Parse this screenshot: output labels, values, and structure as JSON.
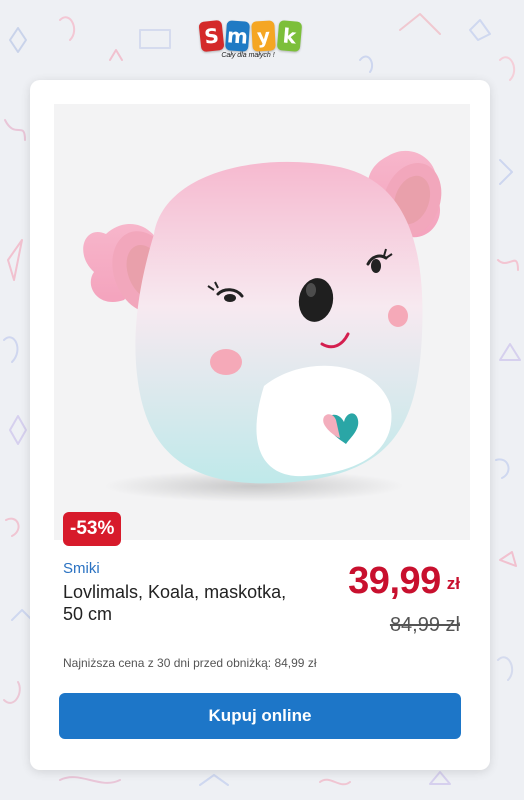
{
  "logo": {
    "letters": [
      "S",
      "m",
      "y",
      "k",
      ""
    ],
    "tagline": "Cały dla małych !",
    "letter_colors": [
      "#d42a2a",
      "#1f7ac4",
      "#f5a623",
      "#7cbf3a",
      "#8e44ad"
    ]
  },
  "product": {
    "discount": "-53%",
    "brand": "Smiki",
    "title": "Lovlimals, Koala, maskotka, 50 cm",
    "price": "39,99",
    "currency": "zł",
    "old_price": "84,99 zł",
    "lowest_price_note": "Najniższa cena z 30 dni przed obniżką: 84,99 zł",
    "image_icon": "koala-plush-image"
  },
  "actions": {
    "buy_label": "Kupuj online"
  },
  "colors": {
    "accent_red": "#c8102e",
    "badge_red": "#d71a2b",
    "button_blue": "#1d76c8",
    "brand_blue": "#2a72c2"
  }
}
